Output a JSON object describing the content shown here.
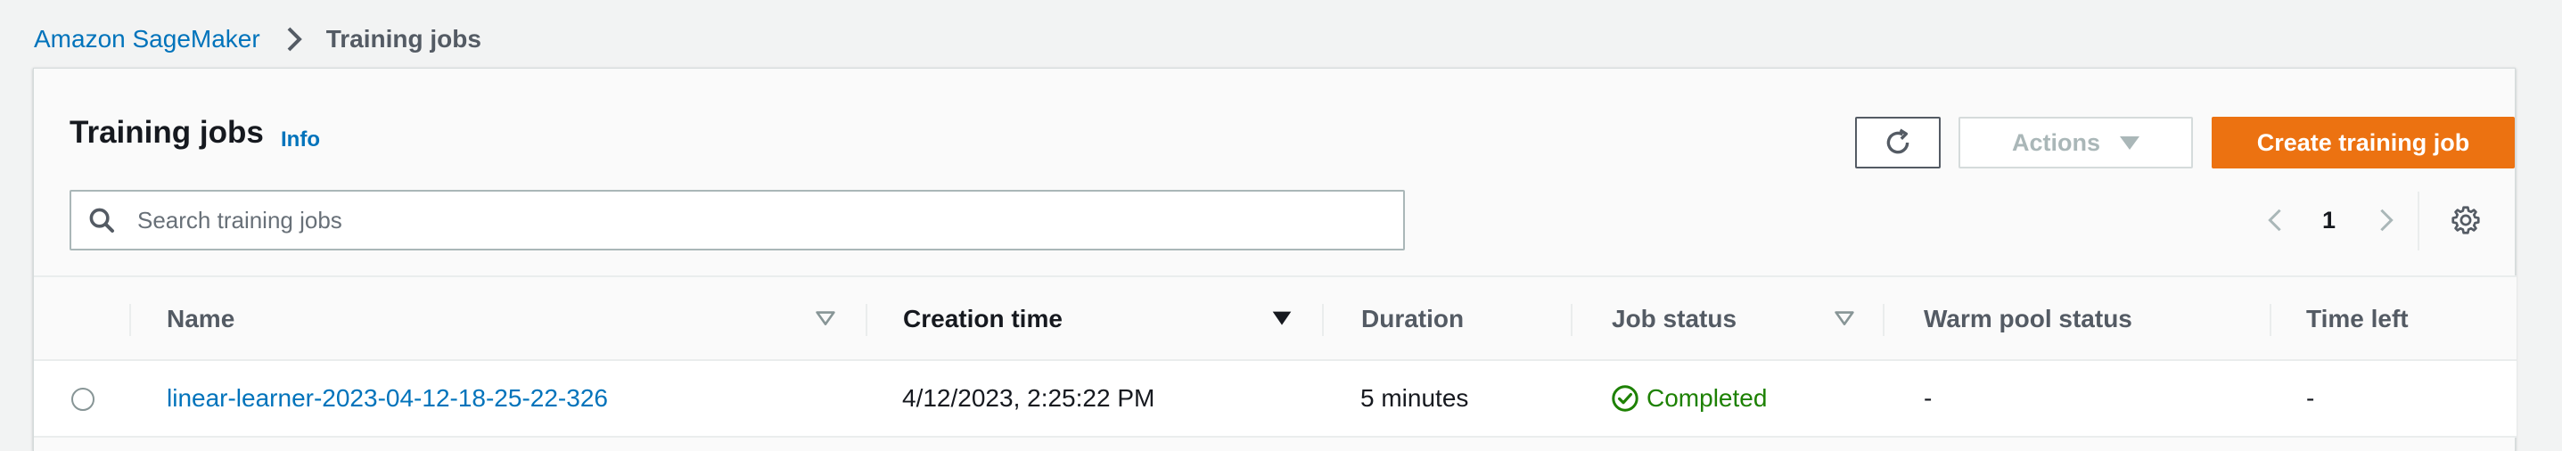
{
  "breadcrumb": {
    "root": "Amazon SageMaker",
    "current": "Training jobs"
  },
  "panel": {
    "title": "Training jobs",
    "info": "Info"
  },
  "toolbar": {
    "refresh_icon": "refresh-icon",
    "actions_label": "Actions",
    "create_label": "Create training job"
  },
  "search": {
    "placeholder": "Search training jobs",
    "value": ""
  },
  "pagination": {
    "current_page": "1"
  },
  "table": {
    "columns": [
      "Name",
      "Creation time",
      "Duration",
      "Job status",
      "Warm pool status",
      "Time left"
    ],
    "sorted_column": "Creation time",
    "sort_direction": "descending",
    "rows": [
      {
        "name": "linear-learner-2023-04-12-18-25-22-326",
        "creation_time": "4/12/2023, 2:25:22 PM",
        "duration": "5 minutes",
        "job_status": "Completed",
        "warm_pool_status": "-",
        "time_left": "-"
      }
    ]
  },
  "colors": {
    "link": "#0073bb",
    "primary_button": "#ec7211",
    "success": "#1d8102",
    "border": "#aab7b8"
  }
}
